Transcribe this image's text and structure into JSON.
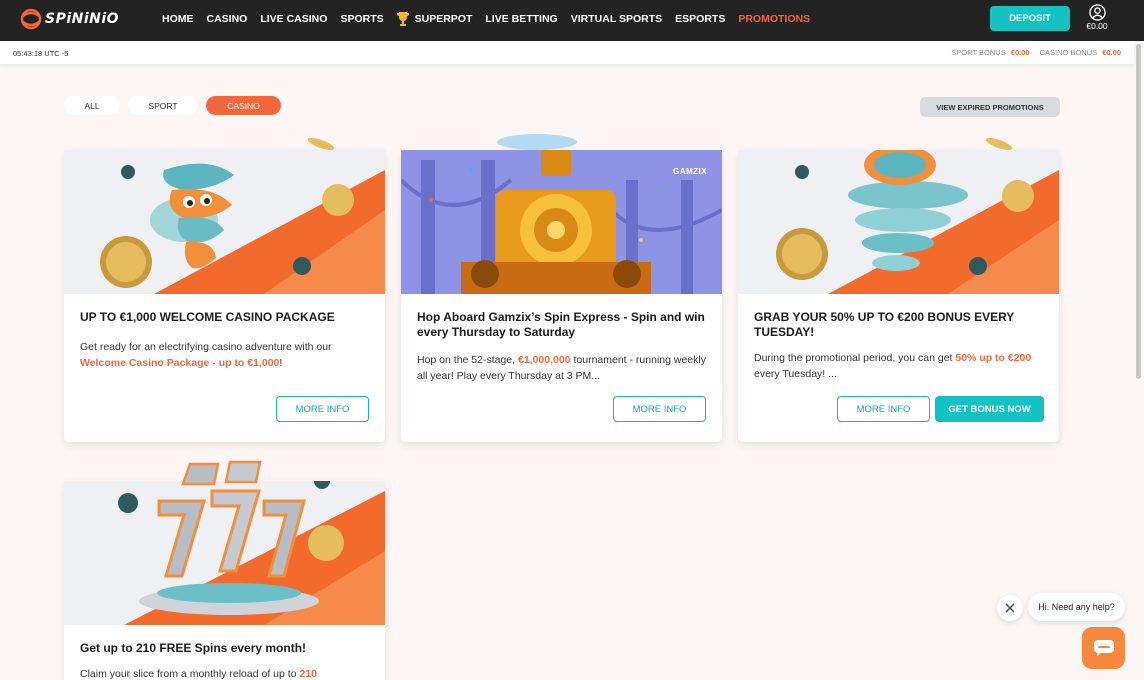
{
  "header": {
    "logo_text": "SPiNiNiO",
    "nav": [
      {
        "label": "HOME"
      },
      {
        "label": "CASINO"
      },
      {
        "label": "LIVE CASINO"
      },
      {
        "label": "SPORTS"
      },
      {
        "label": "SUPERPOT"
      },
      {
        "label": "LIVE BETTING"
      },
      {
        "label": "VIRTUAL SPORTS"
      },
      {
        "label": "ESPORTS"
      },
      {
        "label": "PROMOTIONS"
      }
    ],
    "deposit_label": "DEPOSIT",
    "balance": "€0.00"
  },
  "subbar": {
    "clock": "05:43:18 UTC -5",
    "sport_bonus_label": "SPORT BONUS",
    "sport_bonus_value": "€0.00",
    "casino_bonus_label": "CASINO BONUS",
    "casino_bonus_value": "€0.00"
  },
  "filters": {
    "all": "ALL",
    "sport": "SPORT",
    "casino": "CASINO",
    "active": "CASINO",
    "expired": "VIEW EXPIRED PROMOTIONS"
  },
  "cards": [
    {
      "title": "UP TO €1,000 WELCOME CASINO PACKAGE",
      "desc_pre": "Get ready for an electrifying casino adventure with our ",
      "desc_hl": "Welcome Casino Package - up to €1,000",
      "desc_post": "!",
      "more_info": "MORE INFO"
    },
    {
      "title": "Hop Aboard Gamzix’s Spin Express - Spin and win every Thursday to Saturday",
      "desc_pre": "Hop on the 52-stage, ",
      "desc_hl": "€1,000,000",
      "desc_post": " tournament - running weekly all year! Play every Thursday at 3 PM...",
      "more_info": "MORE INFO",
      "banner_brand": "GAMZIX"
    },
    {
      "title": "GRAB YOUR 50% UP TO €200 BONUS EVERY TUESDAY!",
      "desc_pre": "During the promotional period, you can get ",
      "desc_hl": "50% up to €200",
      "desc_post": " every Tuesday! ...",
      "more_info": "MORE INFO",
      "get_bonus": "GET BONUS NOW"
    },
    {
      "title": "Get up to 210 FREE Spins every month!",
      "desc_pre": "Claim your slice from a monthly reload of up to ",
      "desc_hl": "210",
      "desc_post": ""
    }
  ],
  "chat": {
    "greeting": "Hi. Need any help?"
  },
  "colors": {
    "accent": "#f2673a",
    "teal": "#14c2c2",
    "header_bg": "#232323",
    "page_bg": "#fdf6f4"
  }
}
